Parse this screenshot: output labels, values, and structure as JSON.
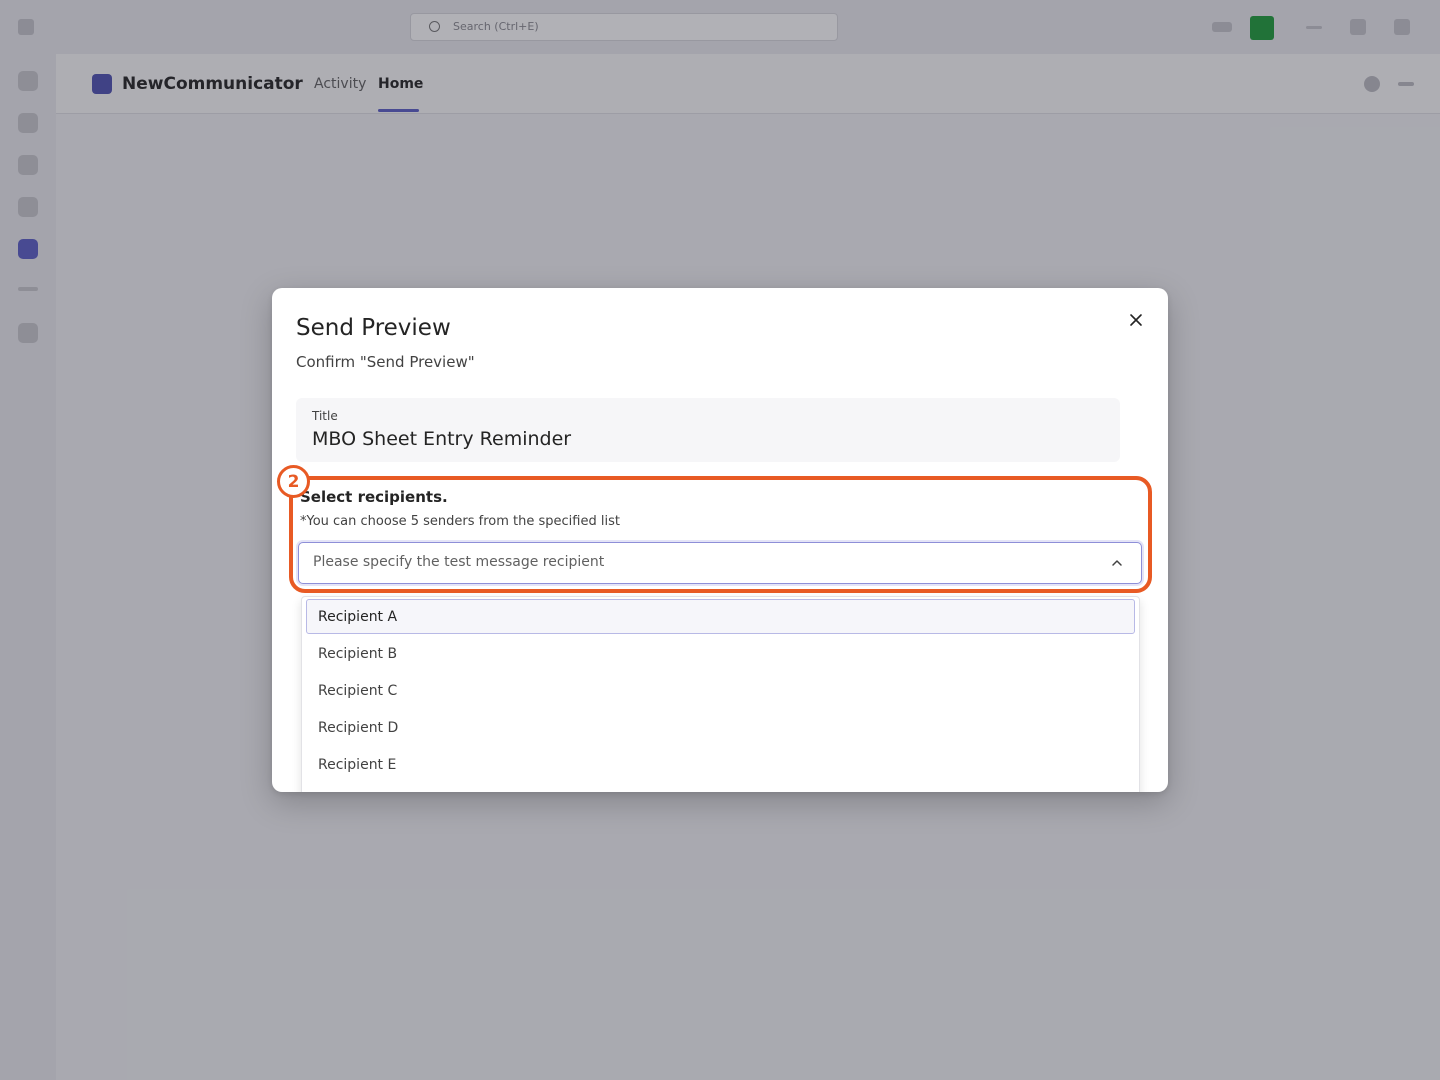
{
  "titlebar": {
    "search_placeholder": "Search (Ctrl+E)"
  },
  "app": {
    "name": "NewCommunicator",
    "tabs": [
      {
        "label": "Activity",
        "active": false
      },
      {
        "label": "Home",
        "active": true
      }
    ]
  },
  "dialog": {
    "title": "Send Preview",
    "subtitle": "Confirm \"Send Preview\"",
    "title_field": {
      "label": "Title",
      "value": "MBO Sheet Entry Reminder"
    },
    "recipients": {
      "label": "Select recipients.",
      "hint": "*You can choose 5 senders from the specified list",
      "placeholder": "Please specify the test message recipient",
      "options": [
        "Recipient A",
        "Recipient B",
        "Recipient C",
        "Recipient D",
        "Recipient E"
      ],
      "highlighted_option": "Recipient A"
    }
  },
  "annotation": {
    "step_number": "2",
    "accent_color": "#e85a24"
  },
  "icons": {
    "close": "close-icon",
    "chevron": "chevron-up-icon",
    "search": "search-icon"
  }
}
